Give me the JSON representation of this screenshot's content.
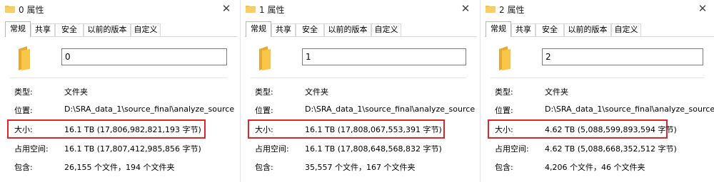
{
  "colors": {
    "highlight": "#e0242c",
    "folder": "#f5c04a"
  },
  "dialogs": [
    {
      "title": "0 属性",
      "name_value": "0",
      "tabs": [
        "常规",
        "共享",
        "安全",
        "以前的版本",
        "自定义"
      ],
      "active_tab": "常规",
      "type_label": "类型:",
      "type_value": "文件夹",
      "location_label": "位置:",
      "location_value": "D:\\SRA_data_1\\source_final\\analyze_source",
      "size_label": "大小:",
      "size_value": "16.1 TB (17,806,982,821,193 字节)",
      "disk_label": "占用空间:",
      "disk_value": "16.1 TB (17,807,412,985,856 字节)",
      "contains_label": "包含:",
      "contains_value": "26,155 个文件，194 个文件夹"
    },
    {
      "title": "1 属性",
      "name_value": "1",
      "tabs": [
        "常规",
        "共享",
        "安全",
        "以前的版本",
        "自定义"
      ],
      "active_tab": "常规",
      "type_label": "类型:",
      "type_value": "文件夹",
      "location_label": "位置:",
      "location_value": "D:\\SRA_data_1\\source_final\\analyze_source",
      "size_label": "大小:",
      "size_value": "16.1 TB (17,808,067,553,391 字节)",
      "disk_label": "占用空间:",
      "disk_value": "16.1 TB (17,808,648,568,832 字节)",
      "contains_label": "包含:",
      "contains_value": "35,557 个文件，167 个文件夹"
    },
    {
      "title": "2 属性",
      "name_value": "2",
      "tabs": [
        "常规",
        "共享",
        "安全",
        "以前的版本",
        "自定义"
      ],
      "active_tab": "常规",
      "type_label": "类型:",
      "type_value": "文件夹",
      "location_label": "位置:",
      "location_value": "D:\\SRA_data_1\\source_final\\analyze_source",
      "size_label": "大小:",
      "size_value": "4.62 TB (5,088,599,893,594 字节)",
      "disk_label": "占用空间:",
      "disk_value": "4.62 TB (5,088,668,352,512 字节)",
      "contains_label": "包含:",
      "contains_value": "4,206 个文件，46 个文件夹"
    }
  ]
}
